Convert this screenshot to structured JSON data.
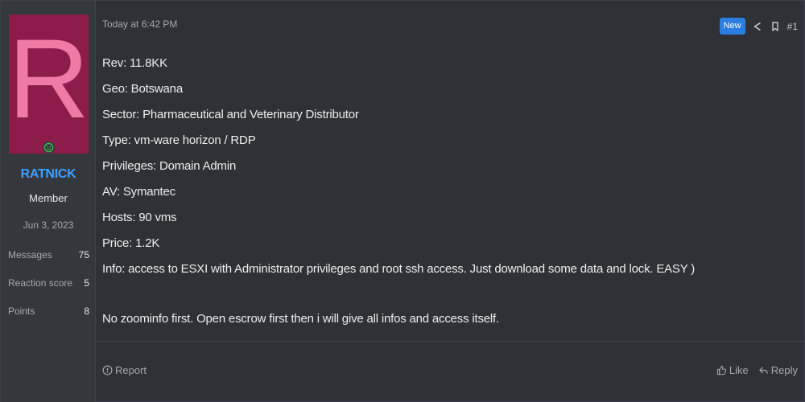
{
  "user": {
    "avatar_letter": "R",
    "username": "RATNICK",
    "title": "Member",
    "join_date": "Jun 3, 2023",
    "stats": [
      {
        "label": "Messages",
        "value": "75"
      },
      {
        "label": "Reaction score",
        "value": "5"
      },
      {
        "label": "Points",
        "value": "8"
      }
    ]
  },
  "post": {
    "date": "Today at 6:42 PM",
    "badge": "New",
    "number": "#1",
    "lines": [
      "Rev: 11.8KK",
      "Geo: Botswana",
      "Sector: Pharmaceutical and Veterinary Distributor",
      "Type: vm-ware horizon / RDP",
      "Privileges: Domain Admin",
      "AV: Symantec",
      "Hosts: 90 vms",
      "Price: 1.2K",
      "Info: access to ESXI with Administrator privileges and root ssh access. Just download some data and lock. EASY )"
    ],
    "closing": "No zoominfo first. Open escrow first then i will give all infos and access itself."
  },
  "footer": {
    "report": "Report",
    "like": "Like",
    "reply": "Reply"
  },
  "colors": {
    "avatar_bg": "#8c1d4a",
    "avatar_fg": "#f07aa6",
    "username": "#3ea0ff",
    "badge": "#2b7de0",
    "online": "#3fb950"
  },
  "icons": [
    "online-status-icon",
    "share-icon",
    "bookmark-icon",
    "report-icon",
    "thumbs-up-icon",
    "reply-icon"
  ]
}
